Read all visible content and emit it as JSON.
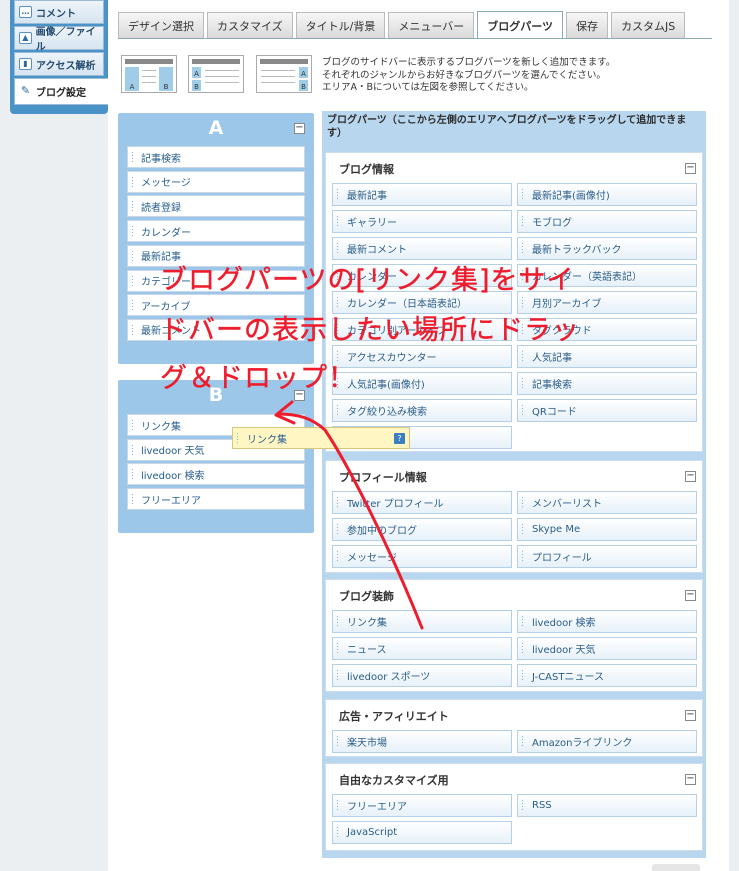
{
  "leftnav": {
    "items": [
      {
        "label": "コメント",
        "icon": "speech-bubble-icon"
      },
      {
        "label": "画像／ファイル",
        "icon": "image-icon"
      },
      {
        "label": "アクセス解析",
        "icon": "bar-chart-icon"
      },
      {
        "label": "ブログ設定",
        "icon": "wrench-icon",
        "active": true
      }
    ]
  },
  "tabs": [
    {
      "label": "デザイン選択"
    },
    {
      "label": "カスタマイズ"
    },
    {
      "label": "タイトル/背景"
    },
    {
      "label": "メニューバー"
    },
    {
      "label": "ブログパーツ",
      "active": true
    },
    {
      "label": "保存"
    },
    {
      "label": "カスタムJS"
    }
  ],
  "header": {
    "desc_line1": "ブログのサイドバーに表示するブログパーツを新しく追加できます。",
    "desc_line2": "それぞれのジャンルからお好きなブログパーツを選んでください。",
    "desc_line3": "エリアA・Bについては左図を参照してください。",
    "thumb_a": "A",
    "thumb_b": "B"
  },
  "areaA": {
    "letter": "A",
    "items": [
      "記事検索",
      "メッセージ",
      "読者登録",
      "カレンダー",
      "最新記事",
      "カテゴリー",
      "アーカイブ",
      "最新コメント"
    ]
  },
  "areaB": {
    "letter": "B",
    "items": [
      "リンク集",
      "livedoor 天気",
      "livedoor 検索",
      "フリーエリア"
    ]
  },
  "panel": {
    "title": "ブログパーツ（ここから左側のエリアへブログパーツをドラッグして追加できます）",
    "sections": [
      {
        "title": "ブログ情報",
        "items": [
          "最新記事",
          "最新記事(画像付)",
          "ギャラリー",
          "モブログ",
          "最新コメント",
          "最新トラックバック",
          "カレンダー",
          "カレンダー（英語表記）",
          "カレンダー（日本語表記）",
          "月別アーカイブ",
          "カテゴリ別アーカイブ",
          "タグクラウド",
          "アクセスカウンター",
          "人気記事",
          "人気記事(画像付)",
          "記事検索",
          "タグ絞り込み検索",
          "QRコード",
          ""
        ]
      },
      {
        "title": "プロフィール情報",
        "items": [
          "Twitter プロフィール",
          "メンバーリスト",
          "参加中のブログ",
          "Skype Me",
          "メッセージ",
          "プロフィール"
        ]
      },
      {
        "title": "ブログ装飾",
        "items": [
          "リンク集",
          "livedoor 検索",
          "ニュース",
          "livedoor 天気",
          "livedoor スポーツ",
          "J-CASTニュース"
        ]
      },
      {
        "title": "広告・アフィリエイト",
        "items": [
          "楽天市場",
          "Amazonライブリンク"
        ]
      },
      {
        "title": "自由なカスタマイズ用",
        "items": [
          "フリーエリア",
          "RSS",
          "JavaScript"
        ]
      }
    ]
  },
  "ghost": {
    "label": "リンク集",
    "help": "?"
  },
  "annotation": {
    "line1": "ブログパーツの[リンク集]をサイ",
    "line2": "ドバーの表示したい場所にドラッ",
    "line3": "グ＆ドロップ！",
    "color": "#ee1c2c"
  }
}
